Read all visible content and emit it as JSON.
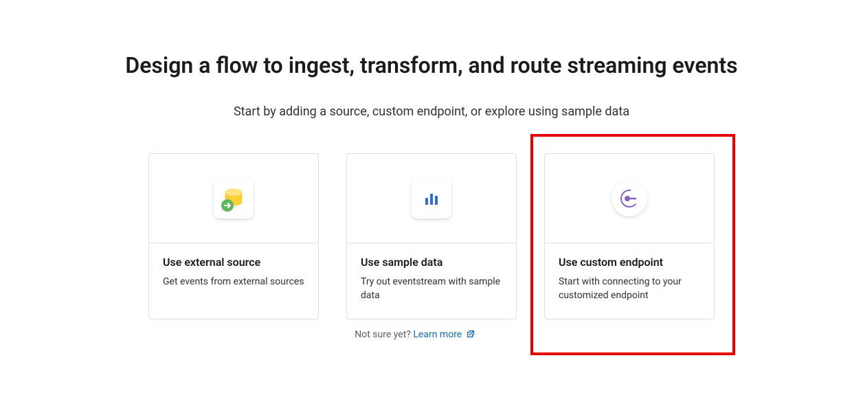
{
  "heading": "Design a flow to ingest, transform, and route streaming events",
  "subheading": "Start by adding a source, custom endpoint, or explore using sample data",
  "cards": [
    {
      "title": "Use external source",
      "description": "Get events from external sources"
    },
    {
      "title": "Use sample data",
      "description": "Try out eventstream with sample data"
    },
    {
      "title": "Use custom endpoint",
      "description": "Start with connecting to your customized endpoint"
    }
  ],
  "footer": {
    "not_sure": "Not sure yet? ",
    "learn_more": "Learn more"
  }
}
